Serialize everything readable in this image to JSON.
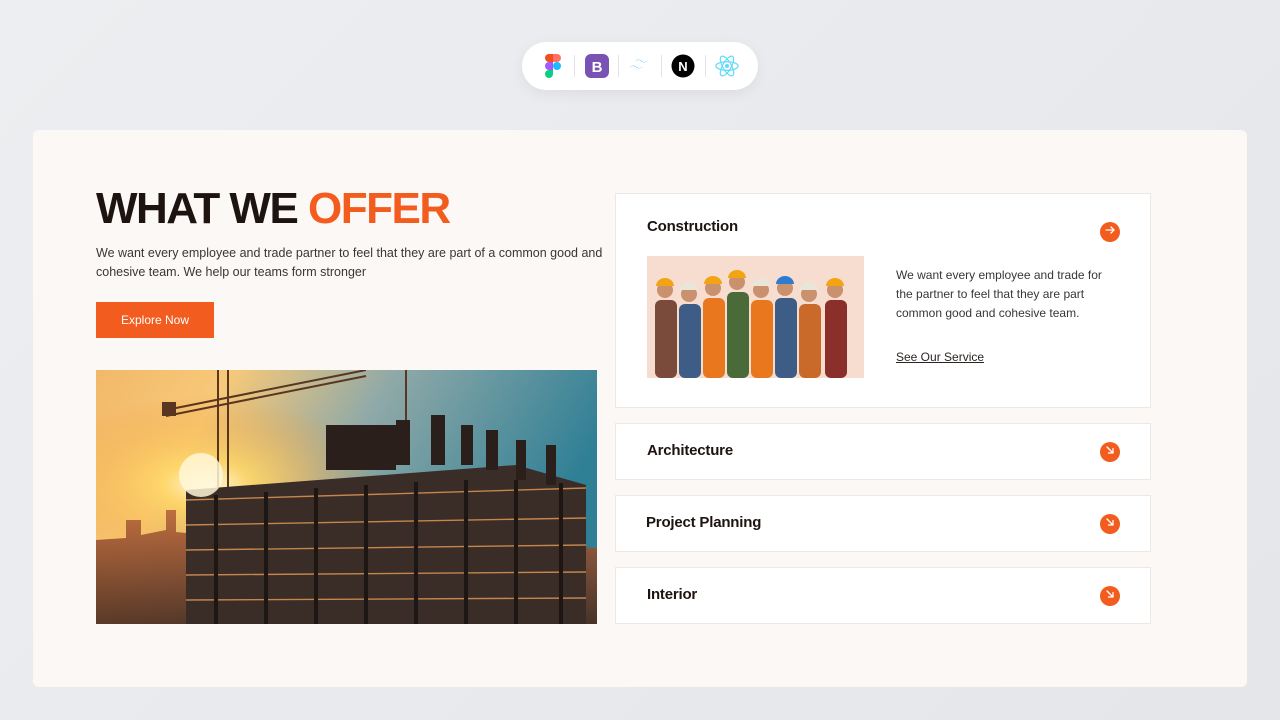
{
  "tech_stack": {
    "icons": [
      "figma-icon",
      "bootstrap-icon",
      "tailwind-icon",
      "nextjs-icon",
      "react-icon"
    ]
  },
  "hero": {
    "headline_part1": "WHAT WE ",
    "headline_part2": "OFFER",
    "intro": "We want every employee and trade partner to feel that they are part of a common good and cohesive team. We help our teams form stronger",
    "cta_label": "Explore Now"
  },
  "services": [
    {
      "title": "Construction",
      "expanded": true,
      "description": "We want every employee and trade for the partner to feel that they are part common good and cohesive team.",
      "link": "See Our Service"
    },
    {
      "title": "Architecture",
      "expanded": false
    },
    {
      "title": "Project Planning",
      "expanded": false
    },
    {
      "title": "Interior",
      "expanded": false
    }
  ],
  "colors": {
    "accent": "#f25c1f",
    "heading": "#1d1410",
    "card_bg": "#fcf8f5"
  }
}
